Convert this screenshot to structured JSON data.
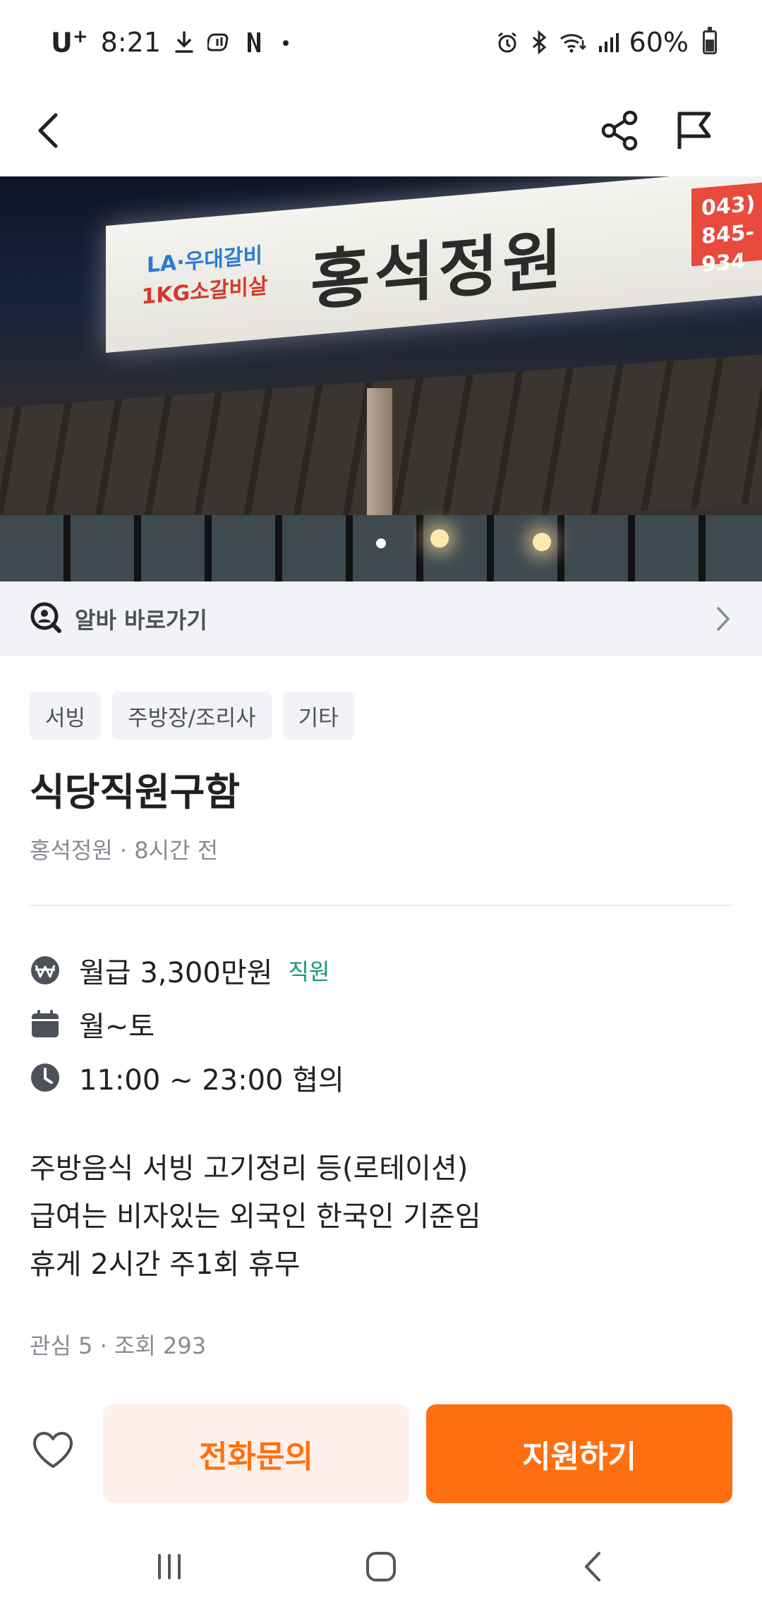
{
  "status_bar": {
    "carrier": "U",
    "carrier_sup": "+",
    "time": "8:21",
    "battery": "60%",
    "battery_level": 0.6,
    "icons": [
      "download-icon",
      "app-icon",
      "netflix-icon",
      "dot-icon",
      "alarm-icon",
      "bluetooth-icon",
      "wifi-icon",
      "signal-icon",
      "battery-icon"
    ]
  },
  "nav": {
    "icons": [
      "back-icon",
      "share-icon",
      "report-flag-icon"
    ]
  },
  "hero": {
    "sign_line1": "LA·우대갈비",
    "sign_line2": "1KG소갈비살",
    "sign_name": "홍석정원",
    "sign_phone_1": "043)",
    "sign_phone_2": "845-934"
  },
  "shortcut": {
    "label": "알바 바로가기",
    "icon": "search-person-icon"
  },
  "tags": [
    "서빙",
    "주방장/조리사",
    "기타"
  ],
  "post": {
    "title": "식당직원구함",
    "meta": "홍석정원 · 8시간 전"
  },
  "info": {
    "pay": "월급 3,300만원",
    "pay_badge": "직원",
    "days": "월~토",
    "hours": "11:00 ~ 23:00 협의"
  },
  "description": [
    "주방음식 서빙 고기정리 등(로테이션)",
    "급여는 비자있는 외국인 한국인 기준임",
    "휴게 2시간 주1회 휴무"
  ],
  "stats": "관심 5 · 조회 293",
  "actions": {
    "call": "전화문의",
    "apply": "지원하기"
  },
  "colors": {
    "accent": "#ff6f0f",
    "accent_light": "#fff1ea",
    "badge_green": "#0f9d6a",
    "muted": "#868b94"
  }
}
